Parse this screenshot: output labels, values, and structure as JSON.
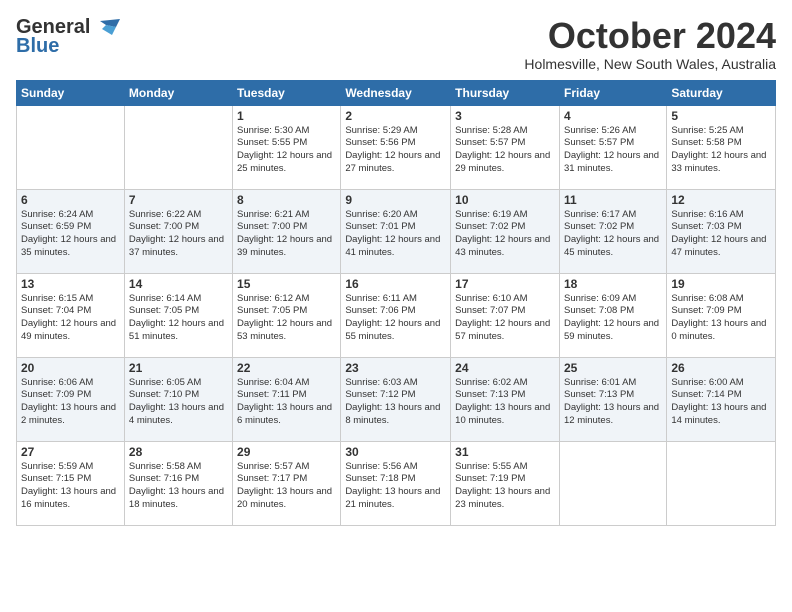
{
  "header": {
    "logo_general": "General",
    "logo_blue": "Blue",
    "month": "October 2024",
    "location": "Holmesville, New South Wales, Australia"
  },
  "days_of_week": [
    "Sunday",
    "Monday",
    "Tuesday",
    "Wednesday",
    "Thursday",
    "Friday",
    "Saturday"
  ],
  "weeks": [
    [
      {
        "day": "",
        "sunrise": "",
        "sunset": "",
        "daylight": ""
      },
      {
        "day": "",
        "sunrise": "",
        "sunset": "",
        "daylight": ""
      },
      {
        "day": "1",
        "sunrise": "Sunrise: 5:30 AM",
        "sunset": "Sunset: 5:55 PM",
        "daylight": "Daylight: 12 hours and 25 minutes."
      },
      {
        "day": "2",
        "sunrise": "Sunrise: 5:29 AM",
        "sunset": "Sunset: 5:56 PM",
        "daylight": "Daylight: 12 hours and 27 minutes."
      },
      {
        "day": "3",
        "sunrise": "Sunrise: 5:28 AM",
        "sunset": "Sunset: 5:57 PM",
        "daylight": "Daylight: 12 hours and 29 minutes."
      },
      {
        "day": "4",
        "sunrise": "Sunrise: 5:26 AM",
        "sunset": "Sunset: 5:57 PM",
        "daylight": "Daylight: 12 hours and 31 minutes."
      },
      {
        "day": "5",
        "sunrise": "Sunrise: 5:25 AM",
        "sunset": "Sunset: 5:58 PM",
        "daylight": "Daylight: 12 hours and 33 minutes."
      }
    ],
    [
      {
        "day": "6",
        "sunrise": "Sunrise: 6:24 AM",
        "sunset": "Sunset: 6:59 PM",
        "daylight": "Daylight: 12 hours and 35 minutes."
      },
      {
        "day": "7",
        "sunrise": "Sunrise: 6:22 AM",
        "sunset": "Sunset: 7:00 PM",
        "daylight": "Daylight: 12 hours and 37 minutes."
      },
      {
        "day": "8",
        "sunrise": "Sunrise: 6:21 AM",
        "sunset": "Sunset: 7:00 PM",
        "daylight": "Daylight: 12 hours and 39 minutes."
      },
      {
        "day": "9",
        "sunrise": "Sunrise: 6:20 AM",
        "sunset": "Sunset: 7:01 PM",
        "daylight": "Daylight: 12 hours and 41 minutes."
      },
      {
        "day": "10",
        "sunrise": "Sunrise: 6:19 AM",
        "sunset": "Sunset: 7:02 PM",
        "daylight": "Daylight: 12 hours and 43 minutes."
      },
      {
        "day": "11",
        "sunrise": "Sunrise: 6:17 AM",
        "sunset": "Sunset: 7:02 PM",
        "daylight": "Daylight: 12 hours and 45 minutes."
      },
      {
        "day": "12",
        "sunrise": "Sunrise: 6:16 AM",
        "sunset": "Sunset: 7:03 PM",
        "daylight": "Daylight: 12 hours and 47 minutes."
      }
    ],
    [
      {
        "day": "13",
        "sunrise": "Sunrise: 6:15 AM",
        "sunset": "Sunset: 7:04 PM",
        "daylight": "Daylight: 12 hours and 49 minutes."
      },
      {
        "day": "14",
        "sunrise": "Sunrise: 6:14 AM",
        "sunset": "Sunset: 7:05 PM",
        "daylight": "Daylight: 12 hours and 51 minutes."
      },
      {
        "day": "15",
        "sunrise": "Sunrise: 6:12 AM",
        "sunset": "Sunset: 7:05 PM",
        "daylight": "Daylight: 12 hours and 53 minutes."
      },
      {
        "day": "16",
        "sunrise": "Sunrise: 6:11 AM",
        "sunset": "Sunset: 7:06 PM",
        "daylight": "Daylight: 12 hours and 55 minutes."
      },
      {
        "day": "17",
        "sunrise": "Sunrise: 6:10 AM",
        "sunset": "Sunset: 7:07 PM",
        "daylight": "Daylight: 12 hours and 57 minutes."
      },
      {
        "day": "18",
        "sunrise": "Sunrise: 6:09 AM",
        "sunset": "Sunset: 7:08 PM",
        "daylight": "Daylight: 12 hours and 59 minutes."
      },
      {
        "day": "19",
        "sunrise": "Sunrise: 6:08 AM",
        "sunset": "Sunset: 7:09 PM",
        "daylight": "Daylight: 13 hours and 0 minutes."
      }
    ],
    [
      {
        "day": "20",
        "sunrise": "Sunrise: 6:06 AM",
        "sunset": "Sunset: 7:09 PM",
        "daylight": "Daylight: 13 hours and 2 minutes."
      },
      {
        "day": "21",
        "sunrise": "Sunrise: 6:05 AM",
        "sunset": "Sunset: 7:10 PM",
        "daylight": "Daylight: 13 hours and 4 minutes."
      },
      {
        "day": "22",
        "sunrise": "Sunrise: 6:04 AM",
        "sunset": "Sunset: 7:11 PM",
        "daylight": "Daylight: 13 hours and 6 minutes."
      },
      {
        "day": "23",
        "sunrise": "Sunrise: 6:03 AM",
        "sunset": "Sunset: 7:12 PM",
        "daylight": "Daylight: 13 hours and 8 minutes."
      },
      {
        "day": "24",
        "sunrise": "Sunrise: 6:02 AM",
        "sunset": "Sunset: 7:13 PM",
        "daylight": "Daylight: 13 hours and 10 minutes."
      },
      {
        "day": "25",
        "sunrise": "Sunrise: 6:01 AM",
        "sunset": "Sunset: 7:13 PM",
        "daylight": "Daylight: 13 hours and 12 minutes."
      },
      {
        "day": "26",
        "sunrise": "Sunrise: 6:00 AM",
        "sunset": "Sunset: 7:14 PM",
        "daylight": "Daylight: 13 hours and 14 minutes."
      }
    ],
    [
      {
        "day": "27",
        "sunrise": "Sunrise: 5:59 AM",
        "sunset": "Sunset: 7:15 PM",
        "daylight": "Daylight: 13 hours and 16 minutes."
      },
      {
        "day": "28",
        "sunrise": "Sunrise: 5:58 AM",
        "sunset": "Sunset: 7:16 PM",
        "daylight": "Daylight: 13 hours and 18 minutes."
      },
      {
        "day": "29",
        "sunrise": "Sunrise: 5:57 AM",
        "sunset": "Sunset: 7:17 PM",
        "daylight": "Daylight: 13 hours and 20 minutes."
      },
      {
        "day": "30",
        "sunrise": "Sunrise: 5:56 AM",
        "sunset": "Sunset: 7:18 PM",
        "daylight": "Daylight: 13 hours and 21 minutes."
      },
      {
        "day": "31",
        "sunrise": "Sunrise: 5:55 AM",
        "sunset": "Sunset: 7:19 PM",
        "daylight": "Daylight: 13 hours and 23 minutes."
      },
      {
        "day": "",
        "sunrise": "",
        "sunset": "",
        "daylight": ""
      },
      {
        "day": "",
        "sunrise": "",
        "sunset": "",
        "daylight": ""
      }
    ]
  ]
}
